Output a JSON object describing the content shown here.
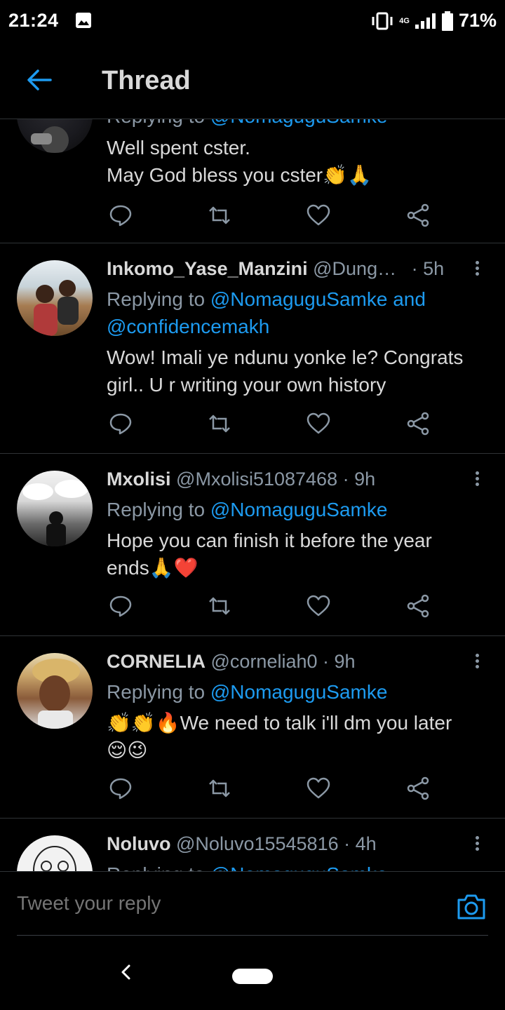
{
  "status_bar": {
    "time": "21:24",
    "network": "4G",
    "battery": "71%"
  },
  "header": {
    "title": "Thread"
  },
  "tweets": [
    {
      "replying_label": "Replying to",
      "replying_to": "@NomaguguSamke",
      "text_line1": "Well spent cster.",
      "text_line2": "May God bless you cster👏🙏"
    },
    {
      "name": "Inkomo_Yase_Manzini",
      "handle": "@Dung…",
      "time": "· 5h",
      "replying_label": "Replying to",
      "replying_to": "@NomaguguSamke and",
      "replying_to_2": "@confidencemakh",
      "text_line1": "Wow! Imali ye ndunu yonke le? Congrats",
      "text_line2": "girl.. U r writing your own history"
    },
    {
      "name": "Mxolisi",
      "handle": "@Mxolisi51087468",
      "time": "· 9h",
      "replying_label": "Replying to",
      "replying_to": "@NomaguguSamke",
      "text_line1": "Hope you can finish it before the year",
      "text_line2": "ends🙏❤️"
    },
    {
      "name": "CORNELIA",
      "handle": "@corneliah0",
      "time": "· 9h",
      "replying_label": "Replying to",
      "replying_to": "@NomaguguSamke",
      "text_line1": "👏👏🔥We need to talk i'll dm you later",
      "text_line2": "😌😉"
    },
    {
      "name": "Noluvo",
      "handle": "@Noluvo15545816",
      "time": "· 4h",
      "replying_label": "Replying to",
      "replying_to": "@NomaguguSamke"
    }
  ],
  "reply_bar": {
    "placeholder": "Tweet your reply"
  },
  "icons": {
    "back": "arrow-left-icon",
    "reply": "reply-icon",
    "retweet": "retweet-icon",
    "like": "heart-icon",
    "share": "share-icon",
    "more": "more-vertical-icon",
    "camera": "camera-icon"
  },
  "colors": {
    "accent": "#1d9bf0",
    "background": "#000000",
    "text": "#d9d9d9",
    "secondary_text": "#8b98a5"
  }
}
